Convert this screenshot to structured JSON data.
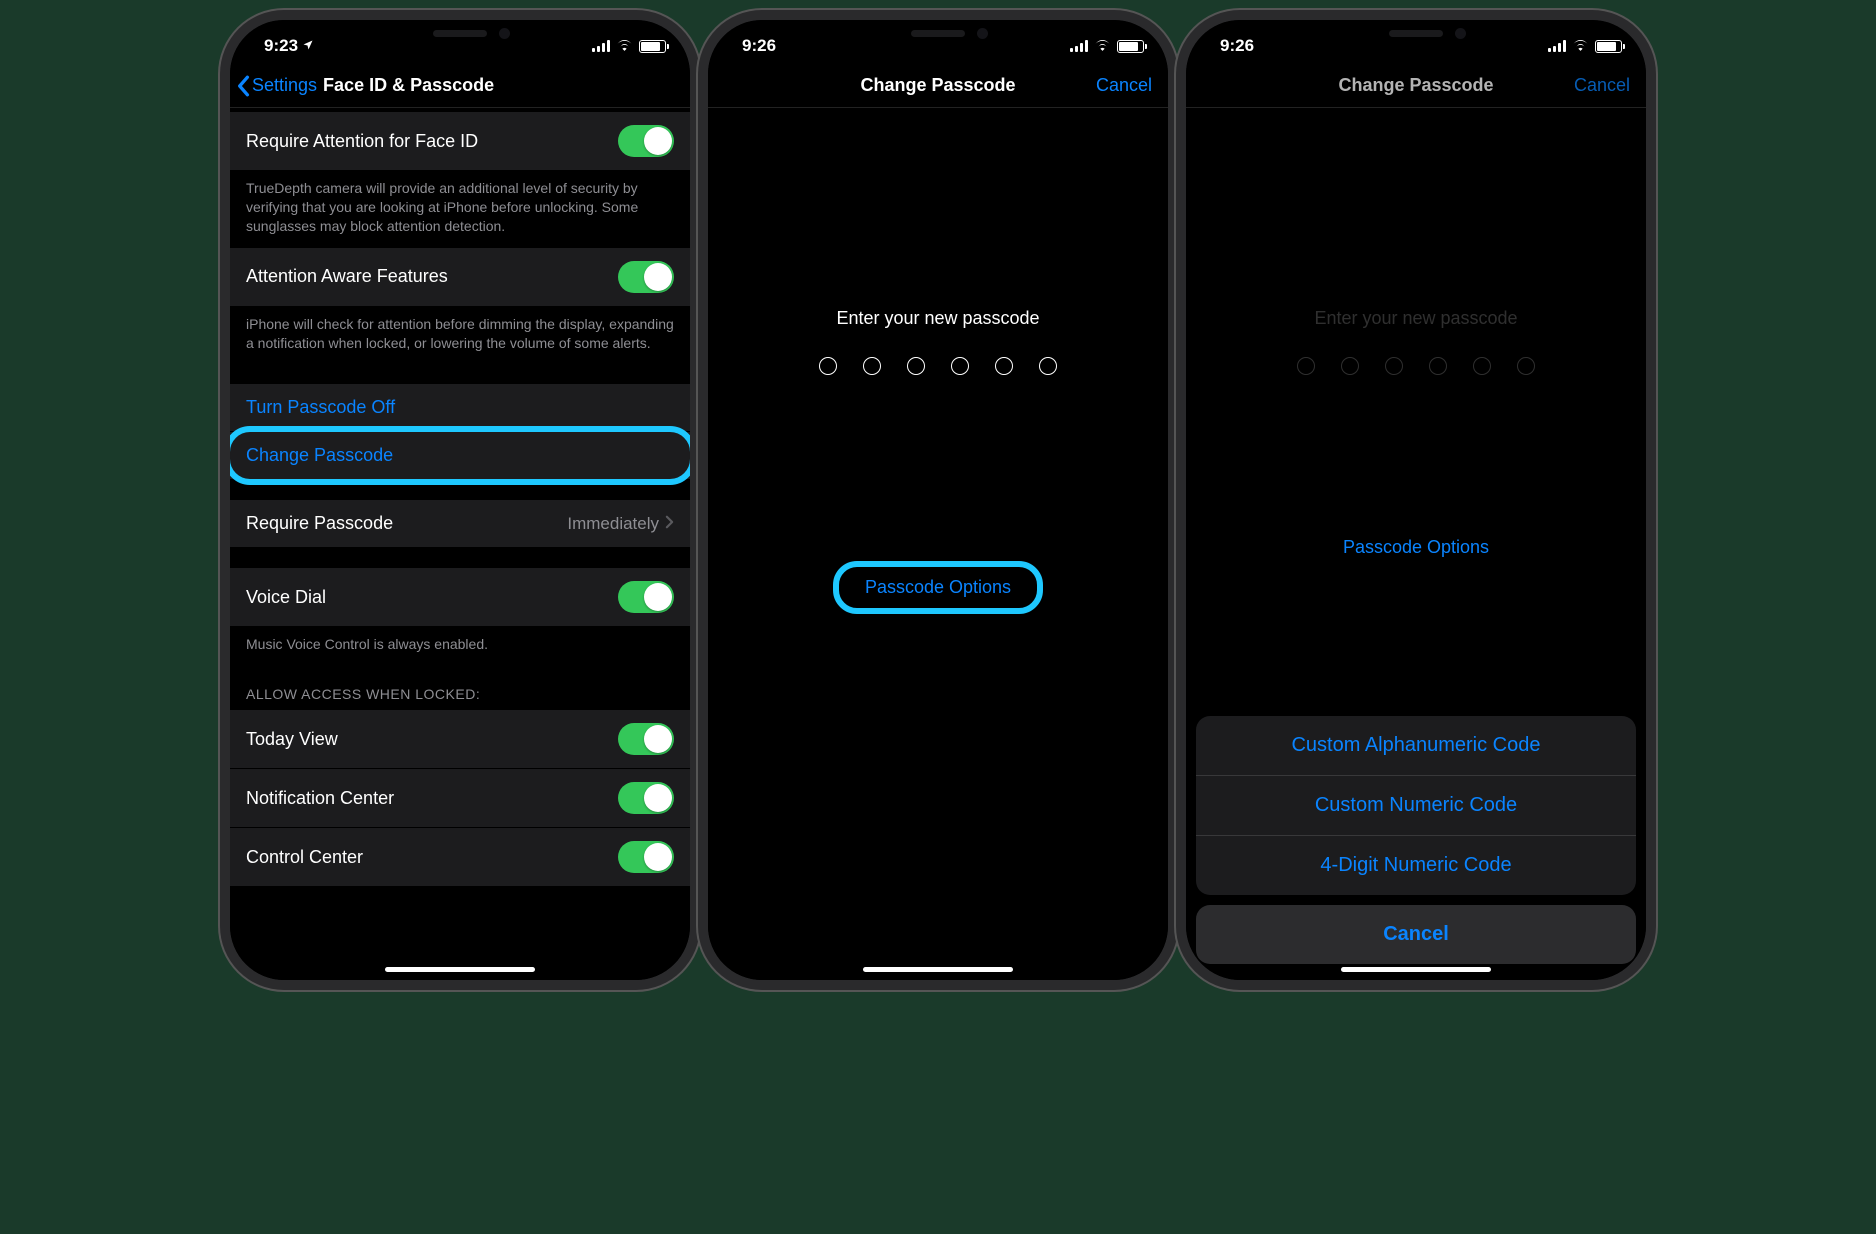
{
  "colors": {
    "accent": "#0a84ff",
    "toggle_on": "#34c759",
    "highlight": "#1ec8ff"
  },
  "screen1": {
    "time": "9:23",
    "nav_back": "Settings",
    "nav_title": "Face ID & Passcode",
    "require_attention": {
      "label": "Require Attention for Face ID",
      "on": true
    },
    "require_attention_footer": "TrueDepth camera will provide an additional level of security by verifying that you are looking at iPhone before unlocking. Some sunglasses may block attention detection.",
    "attention_aware": {
      "label": "Attention Aware Features",
      "on": true
    },
    "attention_aware_footer": "iPhone will check for attention before dimming the display, expanding a notification when locked, or lowering the volume of some alerts.",
    "turn_off": "Turn Passcode Off",
    "change_passcode": "Change Passcode",
    "require_passcode": {
      "label": "Require Passcode",
      "value": "Immediately"
    },
    "voice_dial": {
      "label": "Voice Dial",
      "on": true
    },
    "voice_dial_footer": "Music Voice Control is always enabled.",
    "allow_header": "ALLOW ACCESS WHEN LOCKED:",
    "allow_items": [
      {
        "label": "Today View",
        "on": true
      },
      {
        "label": "Notification Center",
        "on": true
      },
      {
        "label": "Control Center",
        "on": true
      }
    ]
  },
  "screen2": {
    "time": "9:26",
    "nav_title": "Change Passcode",
    "nav_cancel": "Cancel",
    "prompt": "Enter your new passcode",
    "options": "Passcode Options"
  },
  "screen3": {
    "time": "9:26",
    "nav_title": "Change Passcode",
    "nav_cancel": "Cancel",
    "prompt": "Enter your new passcode",
    "options": "Passcode Options",
    "sheet": {
      "items": [
        "Custom Alphanumeric Code",
        "Custom Numeric Code",
        "4-Digit Numeric Code"
      ],
      "cancel": "Cancel"
    }
  }
}
